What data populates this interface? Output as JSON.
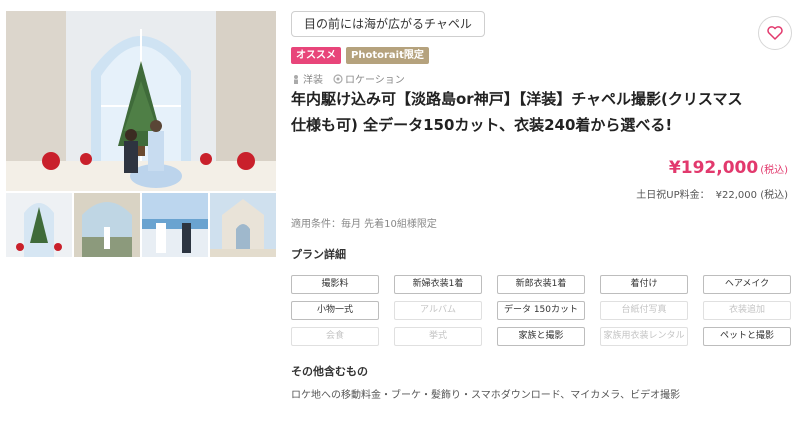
{
  "plan": {
    "catch_copy": "目の前には海が広がるチャペル",
    "badges": [
      "オススメ",
      "Photorait限定"
    ],
    "tags": [
      "洋装",
      "ロケーション"
    ],
    "title": "年内駆け込み可【淡路島or神戸】【洋装】チャペル撮影(クリスマス仕様も可) 全データ150カット、衣装240着から選べる!",
    "price": {
      "amount": "¥192,000",
      "tax_label": "(税込)",
      "holiday_label": "土日祝UP料金：",
      "holiday_amount": "¥22,000 (税込)"
    },
    "conditions": "適用条件：毎月 先着10組様限定",
    "detail_heading": "プラン詳細",
    "details": [
      {
        "label": "撮影料",
        "included": true
      },
      {
        "label": "新婦衣装1着",
        "included": true
      },
      {
        "label": "新郎衣装1着",
        "included": true
      },
      {
        "label": "着付け",
        "included": true
      },
      {
        "label": "ヘアメイク",
        "included": true
      },
      {
        "label": "小物一式",
        "included": true
      },
      {
        "label": "アルバム",
        "included": false
      },
      {
        "label": "データ 150カット",
        "included": true
      },
      {
        "label": "台紙付写真",
        "included": false
      },
      {
        "label": "衣装追加",
        "included": false
      },
      {
        "label": "会食",
        "included": false
      },
      {
        "label": "挙式",
        "included": false
      },
      {
        "label": "家族と撮影",
        "included": true
      },
      {
        "label": "家族用衣装レンタル",
        "included": false
      },
      {
        "label": "ペットと撮影",
        "included": true
      }
    ],
    "others_heading": "その他含むもの",
    "others_text": "ロケ地への移動料金・ブーケ・髪飾り・スマホダウンロード、マイカメラ、ビデオ撮影"
  },
  "icons": {
    "favorite": "heart-icon",
    "tag_yoso": "person-icon",
    "tag_location": "location-icon"
  },
  "colors": {
    "accent_pink": "#e2396d",
    "badge_osusume": "#e8457a",
    "badge_photorait": "#b5a27d",
    "disabled_text": "#c4c4c4"
  }
}
